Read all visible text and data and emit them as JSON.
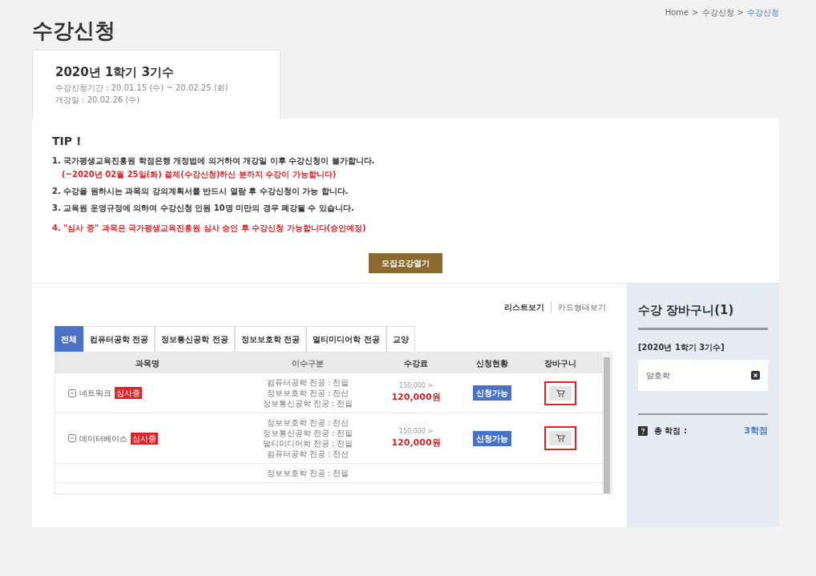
{
  "breadcrumb": [
    {
      "label": "Home",
      "current": false
    },
    {
      "label": "수강신청",
      "current": false
    },
    {
      "label": "수강신청",
      "current": true
    }
  ],
  "breadcrumb_separator": ">",
  "page_title": "수강신청",
  "term_card": {
    "title": "2020년 1학기 3기수",
    "period": "수강신청기간 : 20.01.15 (수) ~ 20.02.25 (화)",
    "start": "개강일 : 20.02.26 (수)"
  },
  "tip": {
    "title": "TIP !",
    "items": [
      {
        "text": "1. 국가평생교육진흥원 학점은행 개정법에 의거하여 개강일 이후 수강신청이 불가합니다.",
        "highlight": false
      },
      {
        "text": "(~2020년 02월 25일(화) 결제(수강신청)하신 분까지 수강이 가능합니다)",
        "highlight": true
      },
      {
        "text": "2. 수강을 원하시는 과목의 강의계획서를 반드시 열람 후 수강신청이 가능 합니다.",
        "highlight": false
      },
      {
        "text": "3. 교육원 운영규정에 의하여 수강신청 인원 10명 미만의 경우 폐강될 수 있습니다.",
        "highlight": false
      },
      {
        "text": "4. \"심사 중\" 과목은 국가평생교육진흥원 심사 승인 후 수강신청 가능합니다(승인예정)",
        "highlight": true
      }
    ]
  },
  "guide_button": "모집요강열기",
  "view_links": [
    {
      "label": "리스트보기",
      "selected": true
    },
    {
      "label": "카드형태보기",
      "selected": false
    }
  ],
  "tabs": [
    {
      "label": "전체",
      "selected": true
    },
    {
      "label": "컴퓨터공학 전공",
      "selected": false
    },
    {
      "label": "정보통신공학 전공",
      "selected": false
    },
    {
      "label": "정보보호학 전공",
      "selected": false
    },
    {
      "label": "멀티미디어학 전공",
      "selected": false
    },
    {
      "label": "교양",
      "selected": false
    }
  ],
  "table": {
    "columns": [
      "과목명",
      "이수구분",
      "수강료",
      "신청현황",
      "장바구니"
    ],
    "rows": [
      {
        "name": "네트워크",
        "badge": "심사중",
        "types": [
          "컴퓨터공학 전공 : 전필",
          "정보보호학 전공 : 전선",
          "정보통신공학 전공 : 전필"
        ],
        "old_price": "150,000 >",
        "price": "120,000원",
        "status": "신청가능",
        "in_cart": true
      },
      {
        "name": "데이터베이스",
        "badge": "심사중",
        "types": [
          "정보보호학 전공 : 전선",
          "정보통신공학 전공 : 전필",
          "멀티미디어학 전공 : 전필",
          "컴퓨터공학 전공 : 전선"
        ],
        "old_price": "150,000 >",
        "price": "120,000원",
        "status": "신청가능",
        "in_cart": true
      },
      {
        "types": [
          "정보보호학 전공 : 전필"
        ]
      }
    ]
  },
  "cart": {
    "title": "수강 장바구니(1)",
    "term": "[2020년 1학기 3기수]",
    "items": [
      "암호학"
    ],
    "total_label": "총 학점 :",
    "total": "3학점"
  }
}
